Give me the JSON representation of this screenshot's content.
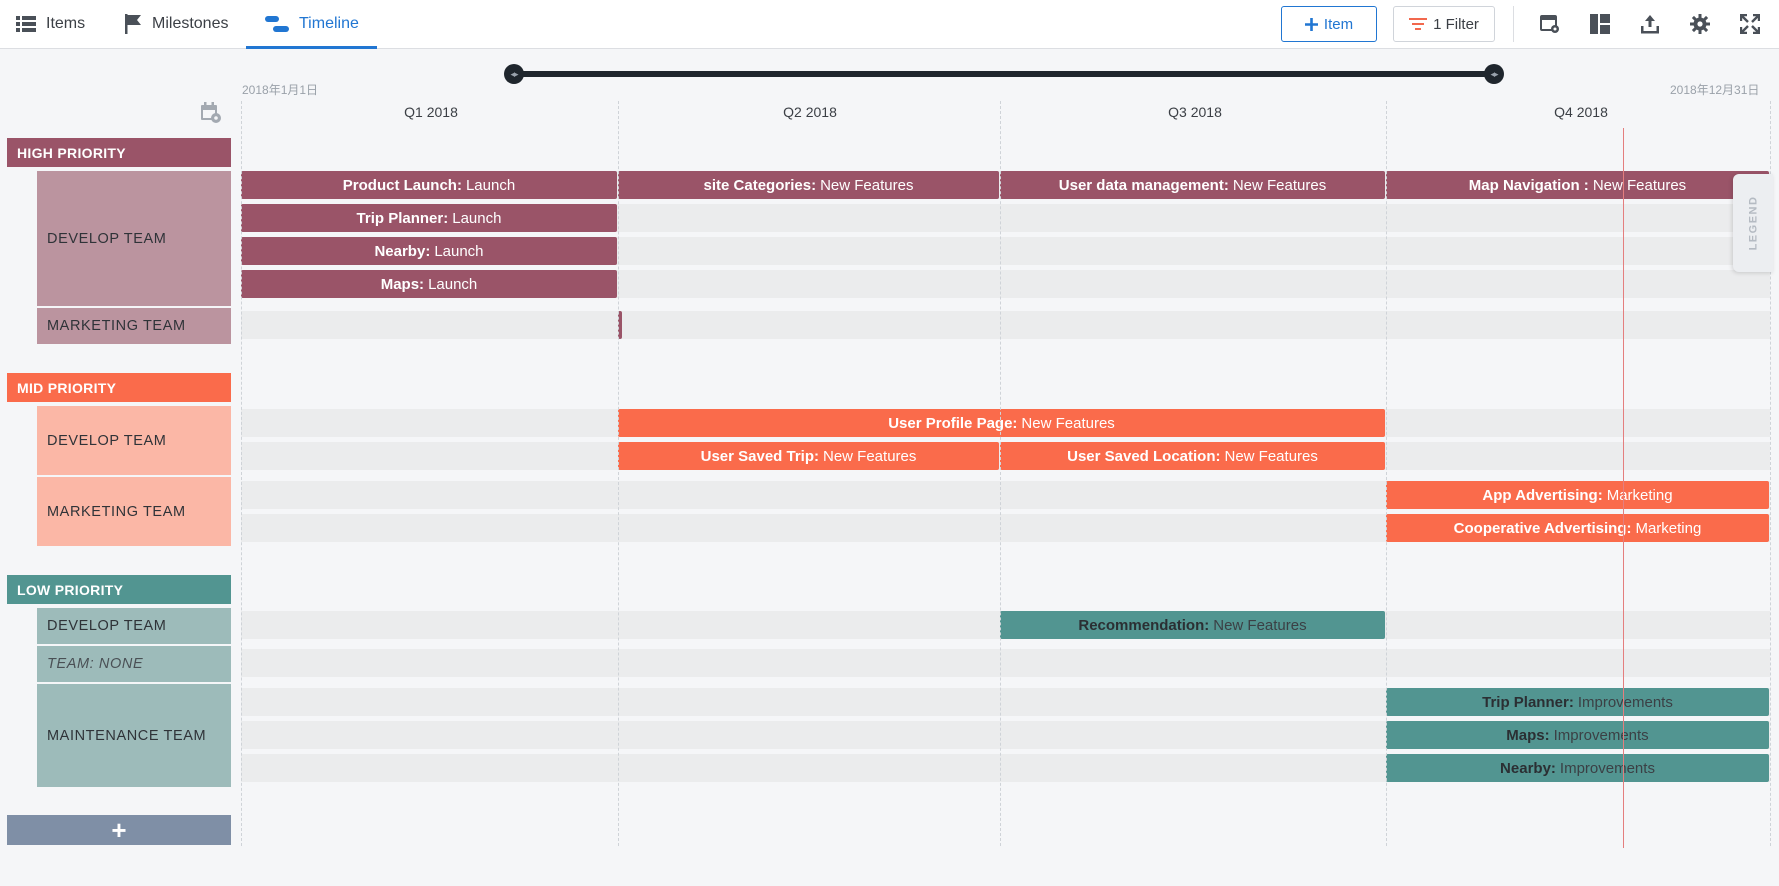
{
  "tabs": [
    {
      "label": "Items",
      "icon": "list-icon",
      "active": false
    },
    {
      "label": "Milestones",
      "icon": "flag-icon",
      "active": false
    },
    {
      "label": "Timeline",
      "icon": "timeline-icon",
      "active": true
    }
  ],
  "toolbar": {
    "add_item_label": "Item",
    "filter_label": "1 Filter",
    "icons": [
      "card-settings-icon",
      "layout-icon",
      "export-icon",
      "gear-icon",
      "fullscreen-icon"
    ]
  },
  "timeline": {
    "start_date": "2018年1月1日",
    "end_date": "2018年12月31日",
    "quarters": [
      "Q1 2018",
      "Q2 2018",
      "Q3 2018",
      "Q4 2018"
    ],
    "legend_label": "LEGEND"
  },
  "groups": [
    {
      "name": "HIGH PRIORITY",
      "color": "#9a5468",
      "team_color": "#bb949f",
      "teams": [
        {
          "name": "DEVELOP TEAM",
          "rows": [
            [
              {
                "title": "Product Launch:",
                "subtitle": "Launch"
              },
              {
                "title": "site Categories:",
                "subtitle": "New Features"
              },
              {
                "title": "User data management:",
                "subtitle": "New Features"
              },
              {
                "title": "Map Navigation :",
                "subtitle": "New Features"
              }
            ],
            [
              {
                "title": "Trip Planner:",
                "subtitle": "Launch"
              }
            ],
            [
              {
                "title": "Nearby:",
                "subtitle": "Launch"
              }
            ],
            [
              {
                "title": "Maps:",
                "subtitle": "Launch"
              }
            ]
          ]
        },
        {
          "name": "MARKETING TEAM",
          "rows": [
            []
          ]
        }
      ]
    },
    {
      "name": "MID PRIORITY",
      "color": "#fa6b4b",
      "team_color": "#fbb7a6",
      "teams": [
        {
          "name": "DEVELOP TEAM",
          "rows": [
            [
              {
                "title": "User Profile Page:",
                "subtitle": "New Features"
              }
            ],
            [
              {
                "title": "User Saved Trip:",
                "subtitle": "New Features"
              },
              {
                "title": "User Saved Location:",
                "subtitle": "New Features"
              }
            ]
          ]
        },
        {
          "name": "MARKETING TEAM",
          "rows": [
            [
              {
                "title": "App Advertising:",
                "subtitle": "Marketing"
              }
            ],
            [
              {
                "title": "Cooperative Advertising:",
                "subtitle": "Marketing"
              }
            ]
          ]
        }
      ]
    },
    {
      "name": "LOW PRIORITY",
      "color": "#529591",
      "team_color": "#9dbbba",
      "teams": [
        {
          "name": "DEVELOP TEAM",
          "rows": [
            [
              {
                "title": "Recommendation:",
                "subtitle": "New Features"
              }
            ]
          ]
        },
        {
          "name": "TEAM: NONE",
          "rows": [
            []
          ]
        },
        {
          "name": "MAINTENANCE TEAM",
          "rows": [
            [
              {
                "title": "Trip Planner:",
                "subtitle": "Improvements"
              }
            ],
            [
              {
                "title": "Maps:",
                "subtitle": "Improvements"
              }
            ],
            [
              {
                "title": "Nearby:",
                "subtitle": "Improvements"
              }
            ]
          ]
        }
      ]
    }
  ],
  "add_group_label": "+"
}
